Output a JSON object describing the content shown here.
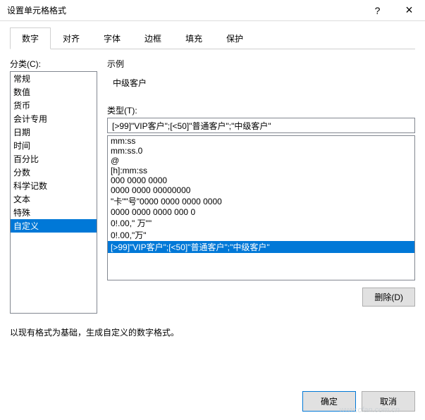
{
  "title": "设置单元格格式",
  "titlebar": {
    "help": "?",
    "close": "×"
  },
  "tabs": [
    "数字",
    "对齐",
    "字体",
    "边框",
    "填充",
    "保护"
  ],
  "active_tab": 0,
  "category_label": "分类(C):",
  "categories": [
    "常规",
    "数值",
    "货币",
    "会计专用",
    "日期",
    "时间",
    "百分比",
    "分数",
    "科学记数",
    "文本",
    "特殊",
    "自定义"
  ],
  "selected_category": 11,
  "sample_label": "示例",
  "sample_value": "中级客户",
  "type_label": "类型(T):",
  "type_input": "[>99]\"VIP客户\";[<50]\"普通客户\";\"中级客户\"",
  "type_list": [
    "mm:ss",
    "mm:ss.0",
    "@",
    "[h]:mm:ss",
    "000 0000 0000",
    "0000 0000 00000000",
    "\"卡\"\"号\"0000 0000 0000 0000",
    "0000 0000 0000 000 0",
    "0!.00,\" 万\"\"",
    "0!.00,\"万\"",
    "[>99]\"VIP客户\";[<50]\"普通客户\";\"中级客户\""
  ],
  "selected_type": 10,
  "delete_btn": "删除(D)",
  "hint": "以现有格式为基础，生成自定义的数字格式。",
  "ok_btn": "确定",
  "cancel_btn": "取消",
  "watermark": "www.cfan.com.cn"
}
